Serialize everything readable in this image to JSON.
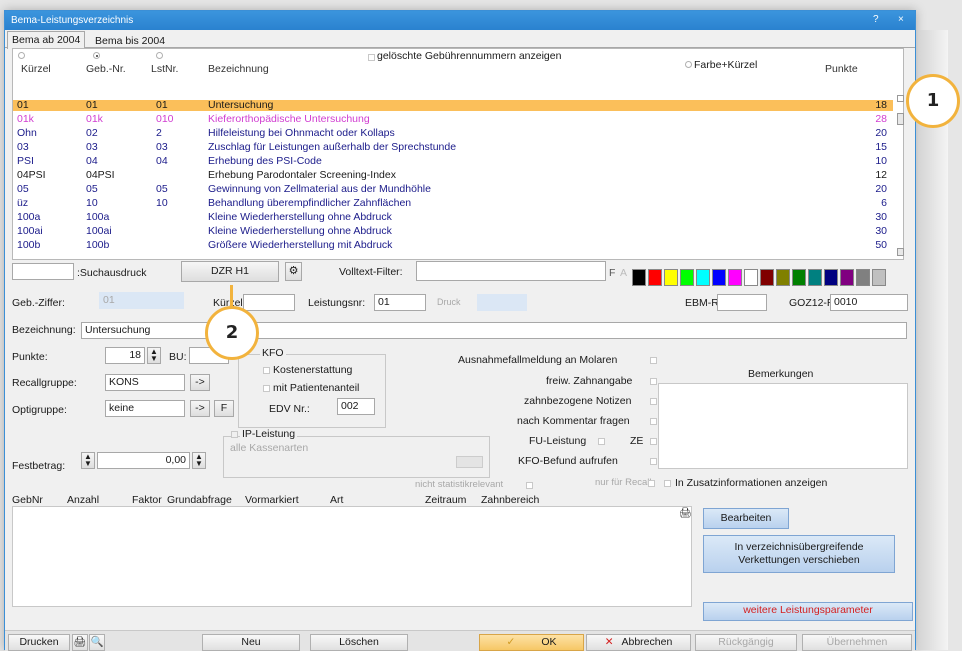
{
  "window": {
    "title": "Bema-Leistungsverzeichnis",
    "help": "?",
    "close": "×"
  },
  "tabs": [
    "Bema ab 2004",
    "Bema bis 2004"
  ],
  "list": {
    "show_deleted_label": "gelöschte Gebührennummern anzeigen",
    "color_label": "Farbe+Kürzel",
    "columns": [
      "Kürzel",
      "Geb.-Nr.",
      "LstNr.",
      "Bezeichnung",
      "Punkte"
    ],
    "rows": [
      {
        "kuerzel": "01",
        "geb": "01",
        "lst": "01",
        "bez": "Untersuchung",
        "punkte": "18",
        "color": "#1a1a1a"
      },
      {
        "kuerzel": "01k",
        "geb": "01k",
        "lst": "010",
        "bez": "Kieferorthopädische Untersuchung",
        "punkte": "28",
        "color": "#d13dd1"
      },
      {
        "kuerzel": "Ohn",
        "geb": "02",
        "lst": "2",
        "bez": "Hilfeleistung bei Ohnmacht oder Kollaps",
        "punkte": "20",
        "color": "#1b1b8a"
      },
      {
        "kuerzel": "03",
        "geb": "03",
        "lst": "03",
        "bez": "Zuschlag für Leistungen außerhalb der Sprechstunde",
        "punkte": "15",
        "color": "#1b1b8a"
      },
      {
        "kuerzel": "PSI",
        "geb": "04",
        "lst": "04",
        "bez": "Erhebung des PSI-Code",
        "punkte": "10",
        "color": "#1b1b8a"
      },
      {
        "kuerzel": "04PSI",
        "geb": "04PSI",
        "lst": "",
        "bez": "Erhebung Parodontaler Screening-Index",
        "punkte": "12",
        "color": "#1a1a1a"
      },
      {
        "kuerzel": "05",
        "geb": "05",
        "lst": "05",
        "bez": "Gewinnung von Zellmaterial aus der Mundhöhle",
        "punkte": "20",
        "color": "#1b1b8a"
      },
      {
        "kuerzel": "üz",
        "geb": "10",
        "lst": "10",
        "bez": "Behandlung überempfindlicher Zahnflächen",
        "punkte": "6",
        "color": "#1b1b8a"
      },
      {
        "kuerzel": "100a",
        "geb": "100a",
        "lst": "",
        "bez": "Kleine Wiederherstellung ohne Abdruck",
        "punkte": "30",
        "color": "#1b1b8a"
      },
      {
        "kuerzel": "100ai",
        "geb": "100ai",
        "lst": "",
        "bez": "Kleine Wiederherstellung ohne Abdruck",
        "punkte": "30",
        "color": "#1b1b8a"
      },
      {
        "kuerzel": "100b",
        "geb": "100b",
        "lst": "",
        "bez": "Größere Wiederherstellung mit Abdruck",
        "punkte": "50",
        "color": "#1b1b8a"
      }
    ]
  },
  "search": {
    "label": ":Suchausdruck",
    "dzr_button": "DZR H1",
    "fulltext_label": "Volltext-Filter:",
    "f_button": "F",
    "a_button": "A"
  },
  "palette": [
    "#000000",
    "#ff0000",
    "#ffff00",
    "#00ff00",
    "#00ffff",
    "#0000ff",
    "#ff00ff",
    "#ffffff",
    "#800000",
    "#808000",
    "#008000",
    "#008080",
    "#000080",
    "#800080",
    "#808080",
    "#c0c0c0"
  ],
  "form": {
    "geb_label": "Geb.-Ziffer:",
    "geb_value": "01",
    "kuerzel_label": "Kürzel:",
    "leistungsnr_label": "Leistungsnr:",
    "leistungsnr_value": "01",
    "druck_label": "Druck",
    "ebm_label": "EBM-Ref.:",
    "goz_label": "GOZ12-Ref.:",
    "goz_value": "0010",
    "bezeichnung_label": "Bezeichnung:",
    "bezeichnung_value": "Untersuchung",
    "punkte_label": "Punkte:",
    "punkte_value": "18",
    "bu_label": "BU:",
    "recall_label": "Recallgruppe:",
    "recall_value": "KONS",
    "opti_label": "Optigruppe:",
    "opti_value": "keine",
    "arrow": "->",
    "f": "F",
    "kfo_label": "KFO",
    "kosten_label": "Kostenerstattung",
    "patient_label": "mit Patientenanteil",
    "edv_label": "EDV Nr.:",
    "edv_value": "002",
    "ip_label": "IP-Leistung",
    "kassen_label": "alle Kassenarten",
    "fest_label": "Festbetrag:",
    "fest_value": "0,00",
    "right_checks": [
      "Ausnahmefallmeldung an Molaren",
      "freiw. Zahnangabe",
      "zahnbezogene Notizen",
      "nach Kommentar fragen",
      "FU-Leistung",
      "KFO-Befund aufrufen"
    ],
    "ze_label": "ZE",
    "bemerkungen_label": "Bemerkungen",
    "nicht_stat": "nicht statistikrelevant",
    "nur_recall": "nur für Recall",
    "zusatz": "In Zusatzinformationen anzeigen"
  },
  "links": {
    "columns": [
      "GebNr",
      "Anzahl",
      "Faktor",
      "Grundabfrage",
      "Vormarkiert",
      "Art",
      "Zeitraum",
      "Zahnbereich"
    ],
    "edit_button": "Bearbeiten",
    "move_button_line1": "In verzeichnisübergreifende",
    "move_button_line2": "Verkettungen verschieben",
    "more_params": "weitere Leistungsparameter"
  },
  "footer": {
    "print": "Drucken",
    "new": "Neu",
    "delete": "Löschen",
    "ok": "OK",
    "cancel": "Abbrechen",
    "undo": "Rückgängig",
    "apply": "Übernehmen"
  },
  "callouts": [
    "1",
    "2"
  ]
}
